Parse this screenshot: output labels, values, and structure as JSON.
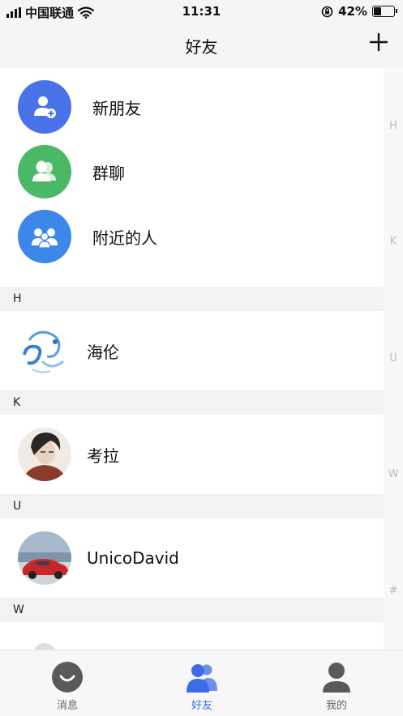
{
  "status_bar": {
    "carrier": "中国联通",
    "time": "11:31",
    "battery_percent": "42%",
    "battery_level": 0.42,
    "icons": [
      "signal-icon",
      "wifi-icon",
      "orientation-lock-icon",
      "battery-icon"
    ]
  },
  "nav": {
    "title": "好友",
    "add_icon": "plus-icon"
  },
  "entries": [
    {
      "label": "新朋友",
      "icon": "add-user-icon",
      "color": "#4a72e8"
    },
    {
      "label": "群聊",
      "icon": "group-icon",
      "color": "#4bb865"
    },
    {
      "label": "附近的人",
      "icon": "people-nearby-icon",
      "color": "#3d86ea"
    }
  ],
  "sections": [
    {
      "letter": "H",
      "contacts": [
        {
          "name": "海伦"
        }
      ]
    },
    {
      "letter": "K",
      "contacts": [
        {
          "name": "考拉"
        }
      ]
    },
    {
      "letter": "U",
      "contacts": [
        {
          "name": "UnicoDavid"
        }
      ]
    },
    {
      "letter": "W",
      "contacts": [
        {
          "name": ""
        }
      ]
    }
  ],
  "index_letters": [
    "H",
    "K",
    "U",
    "W",
    "#"
  ],
  "tabs": [
    {
      "label": "消息",
      "icon": "message-icon",
      "active": false
    },
    {
      "label": "好友",
      "icon": "friends-icon",
      "active": true
    },
    {
      "label": "我的",
      "icon": "profile-icon",
      "active": false
    }
  ],
  "colors": {
    "accent": "#3d6ae6",
    "tab_inactive": "#666666",
    "section_bg": "#f2f2f2",
    "index_text": "#bdbdbd"
  }
}
